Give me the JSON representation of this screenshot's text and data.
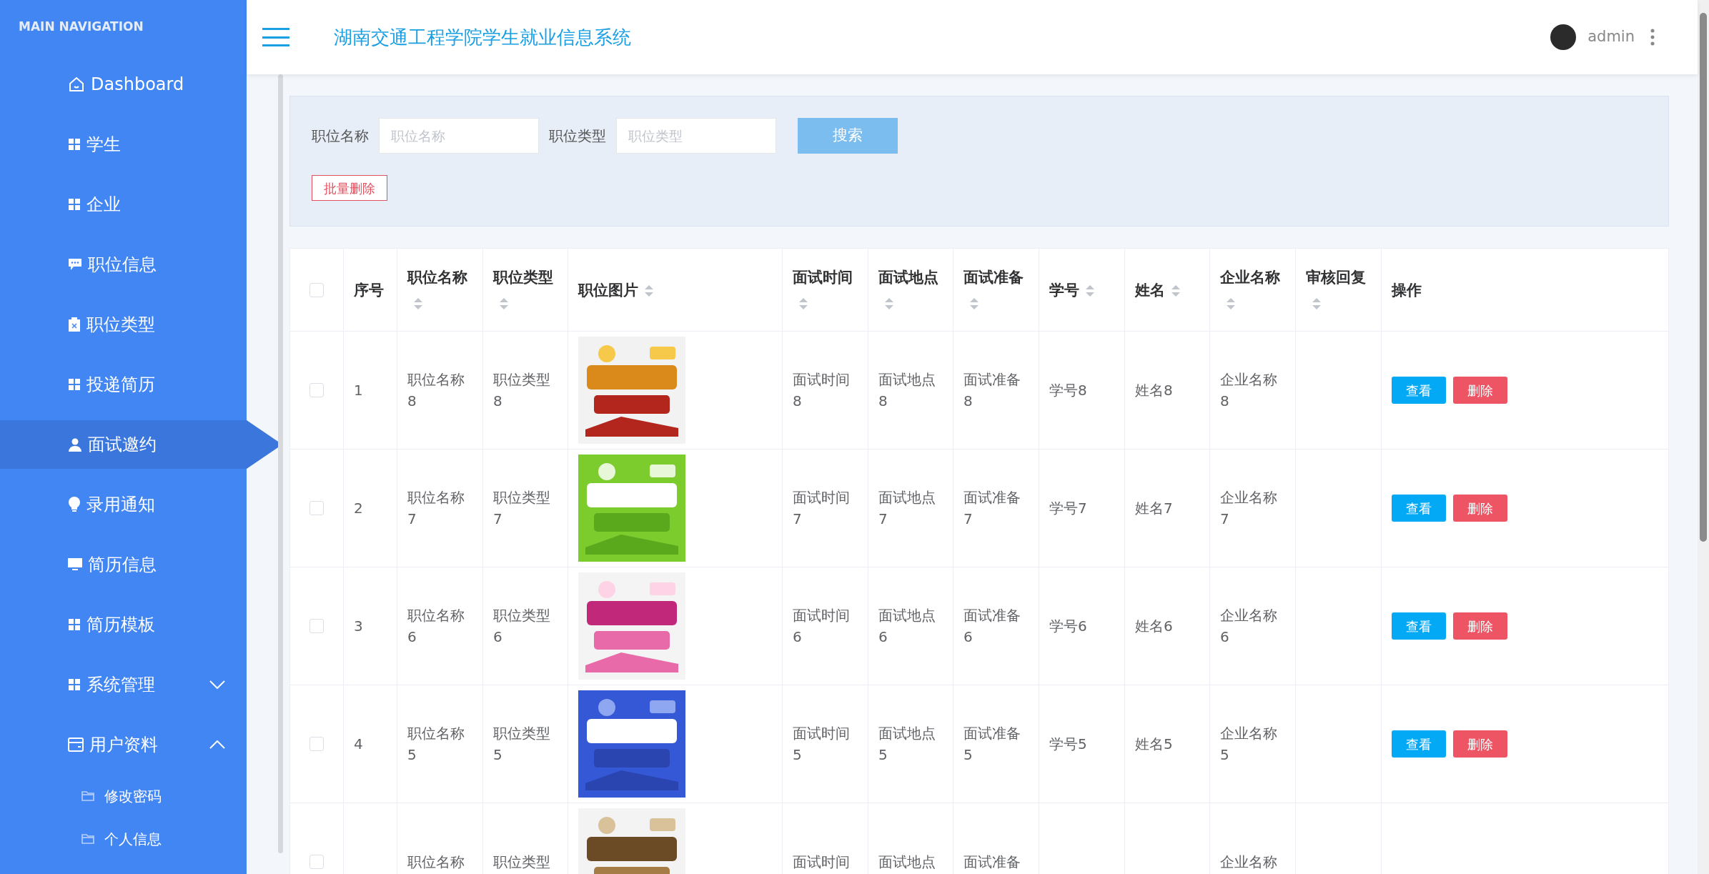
{
  "sidebar": {
    "heading": "MAIN NAVIGATION",
    "items": [
      {
        "label": "Dashboard",
        "selected": false
      },
      {
        "label": "学生",
        "selected": false
      },
      {
        "label": "企业",
        "selected": false
      },
      {
        "label": "职位信息",
        "selected": false
      },
      {
        "label": "职位类型",
        "selected": false
      },
      {
        "label": "投递简历",
        "selected": false
      },
      {
        "label": "面试邀约",
        "selected": true
      },
      {
        "label": "录用通知",
        "selected": false
      },
      {
        "label": "简历信息",
        "selected": false
      },
      {
        "label": "简历模板",
        "selected": false
      },
      {
        "label": "系统管理",
        "selected": false,
        "expanded": false
      },
      {
        "label": "用户资料",
        "selected": false,
        "expanded": true,
        "children": [
          {
            "label": "修改密码",
            "selected": false
          },
          {
            "label": "个人信息",
            "selected": false
          }
        ]
      }
    ]
  },
  "header": {
    "title": "湖南交通工程学院学生就业信息系统",
    "user": "admin"
  },
  "search": {
    "fields": [
      {
        "label": "职位名称",
        "placeholder": "职位名称"
      },
      {
        "label": "职位类型",
        "placeholder": "职位类型"
      }
    ],
    "search_button": "搜索",
    "batch_delete_button": "批量删除"
  },
  "table": {
    "header_checked": false,
    "columns": [
      {
        "label": "序号",
        "sortable": false
      },
      {
        "label": "职位名称",
        "sortable": true
      },
      {
        "label": "职位类型",
        "sortable": true
      },
      {
        "label": "职位图片",
        "sortable": true
      },
      {
        "label": "面试时间",
        "sortable": true
      },
      {
        "label": "面试地点",
        "sortable": true
      },
      {
        "label": "面试准备",
        "sortable": true
      },
      {
        "label": "学号",
        "sortable": true
      },
      {
        "label": "姓名",
        "sortable": true
      },
      {
        "label": "企业名称",
        "sortable": true
      },
      {
        "label": "审核回复",
        "sortable": true
      },
      {
        "label": "操作",
        "sortable": false
      }
    ],
    "rows": [
      {
        "checked": false,
        "cells": [
          "1",
          "职位名称8",
          "职位类型8",
          {
            "kind": "picture"
          },
          "面试时间8",
          "面试地点8",
          "面试准备8",
          "学号8",
          "姓名8",
          "企业名称8",
          ""
        ],
        "actions": [
          "查看",
          "删除"
        ]
      },
      {
        "checked": false,
        "cells": [
          "2",
          "职位名称7",
          "职位类型7",
          {
            "kind": "picture"
          },
          "面试时间7",
          "面试地点7",
          "面试准备7",
          "学号7",
          "姓名7",
          "企业名称7",
          ""
        ],
        "actions": [
          "查看",
          "删除"
        ]
      },
      {
        "checked": false,
        "cells": [
          "3",
          "职位名称6",
          "职位类型6",
          {
            "kind": "picture"
          },
          "面试时间6",
          "面试地点6",
          "面试准备6",
          "学号6",
          "姓名6",
          "企业名称6",
          ""
        ],
        "actions": [
          "查看",
          "删除"
        ]
      },
      {
        "checked": false,
        "cells": [
          "4",
          "职位名称5",
          "职位类型5",
          {
            "kind": "picture"
          },
          "面试时间5",
          "面试地点5",
          "面试准备5",
          "学号5",
          "姓名5",
          "企业名称5",
          ""
        ],
        "actions": [
          "查看",
          "删除"
        ]
      },
      {
        "checked": false,
        "cells": [
          "",
          "职位名称",
          "职位类型",
          {
            "kind": "picture"
          },
          "面试时间",
          "面试地点",
          "面试准备",
          "",
          "",
          "企业名称",
          ""
        ]
      }
    ]
  }
}
